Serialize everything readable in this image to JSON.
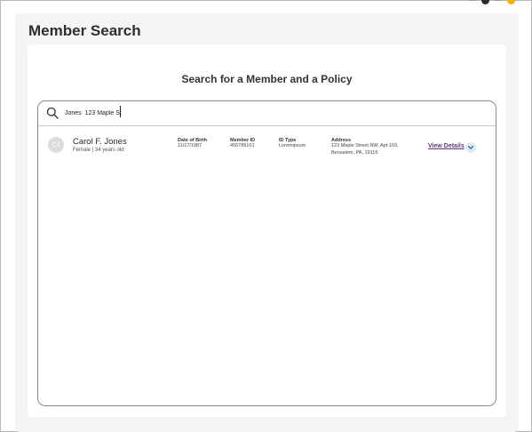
{
  "page": {
    "title": "Member Search"
  },
  "card": {
    "heading": "Search for a Member and a Policy"
  },
  "search": {
    "value": "Jones  123 Maple St",
    "icon": "search-icon"
  },
  "results": [
    {
      "initials": "CJ",
      "name": "Carol F. Jones",
      "subtitle": "Female | 34 years old",
      "dob_label": "Date of Birth",
      "dob": "11/17/1987",
      "member_id_label": "Member ID",
      "member_id": "456789101",
      "id_type_label": "ID Type",
      "id_type": "Loremipsum",
      "address_label": "Address",
      "address_line1": "123 Maple Street NW, Apt 103,",
      "address_line2": "Bensalem, PA, 19116",
      "view_details": "View Details",
      "expand_icon": "chevron-down-icon"
    }
  ],
  "colors": {
    "panel_bg": "#f4f4f4",
    "link": "#5e3a77",
    "chevron_bg": "#d9ebf6",
    "top_accent": "#f2b400"
  }
}
